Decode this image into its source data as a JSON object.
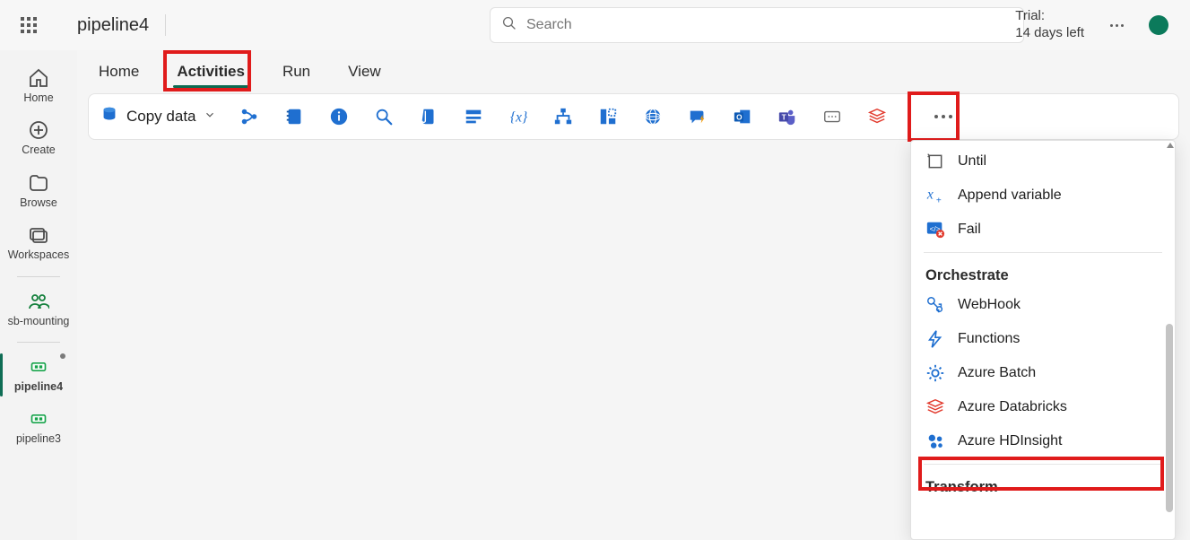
{
  "header": {
    "title": "pipeline4",
    "search_placeholder": "Search",
    "trial_line1": "Trial:",
    "trial_line2": "14 days left"
  },
  "rail": {
    "home": "Home",
    "create": "Create",
    "browse": "Browse",
    "workspaces": "Workspaces",
    "ws1": "sb-mounting",
    "pipeline_active": "pipeline4",
    "pipeline_other": "pipeline3"
  },
  "tabs": {
    "home": "Home",
    "activities": "Activities",
    "run": "Run",
    "view": "View"
  },
  "toolbar": {
    "copy_data": "Copy data"
  },
  "menu": {
    "until": "Until",
    "append_variable": "Append variable",
    "fail": "Fail",
    "group_orchestrate": "Orchestrate",
    "webhook": "WebHook",
    "functions": "Functions",
    "azure_batch": "Azure Batch",
    "azure_databricks": "Azure Databricks",
    "azure_hdinsight": "Azure HDInsight",
    "group_transform": "Transform"
  }
}
